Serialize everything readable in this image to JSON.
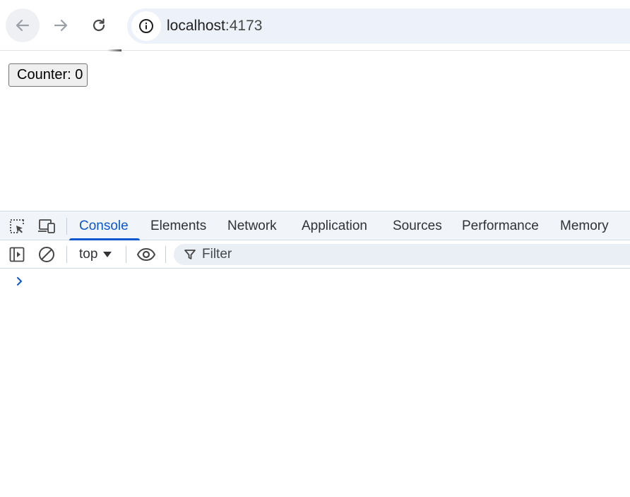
{
  "browser": {
    "url_host": "localhost",
    "url_port": ":4173",
    "icons": {
      "back": "arrow-left-icon",
      "forward": "arrow-right-icon",
      "reload": "reload-icon",
      "site_info": "info-icon"
    }
  },
  "page": {
    "counter_button_label": "Counter: 0"
  },
  "devtools": {
    "tabs": [
      {
        "label": "Console",
        "active": true
      },
      {
        "label": "Elements",
        "active": false
      },
      {
        "label": "Network",
        "active": false
      },
      {
        "label": "Application",
        "active": false
      },
      {
        "label": "Sources",
        "active": false
      },
      {
        "label": "Performance",
        "active": false
      },
      {
        "label": "Memory",
        "active": false
      }
    ],
    "toolbar": {
      "context_label": "top",
      "filter_placeholder": "Filter"
    },
    "colors": {
      "accent": "#0b57d0",
      "tabbar_bg": "#f1f4f9"
    }
  }
}
